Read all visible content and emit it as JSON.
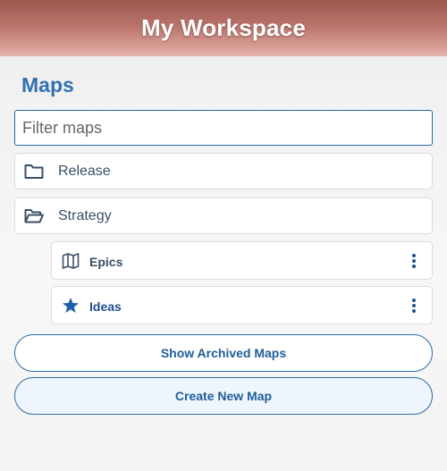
{
  "header": {
    "title": "My Workspace"
  },
  "section": {
    "title": "Maps"
  },
  "filter": {
    "placeholder": "Filter maps",
    "value": ""
  },
  "folders": [
    {
      "label": "Release",
      "icon": "folder-icon"
    },
    {
      "label": "Strategy",
      "icon": "folder-open-icon"
    }
  ],
  "maps": [
    {
      "label": "Epics",
      "icon": "map-icon",
      "label_color": "#3a4f66"
    },
    {
      "label": "Ideas",
      "icon": "star-icon",
      "label_color": "#1f4f8a"
    }
  ],
  "actions": {
    "show_archived_label": "Show Archived Maps",
    "create_new_label": "Create New Map"
  },
  "colors": {
    "accent": "#3271b3",
    "header_gradient_top": "#9b5a4f",
    "header_gradient_bottom": "#e3b3ab",
    "create_button_bg": "#eef5fd"
  }
}
